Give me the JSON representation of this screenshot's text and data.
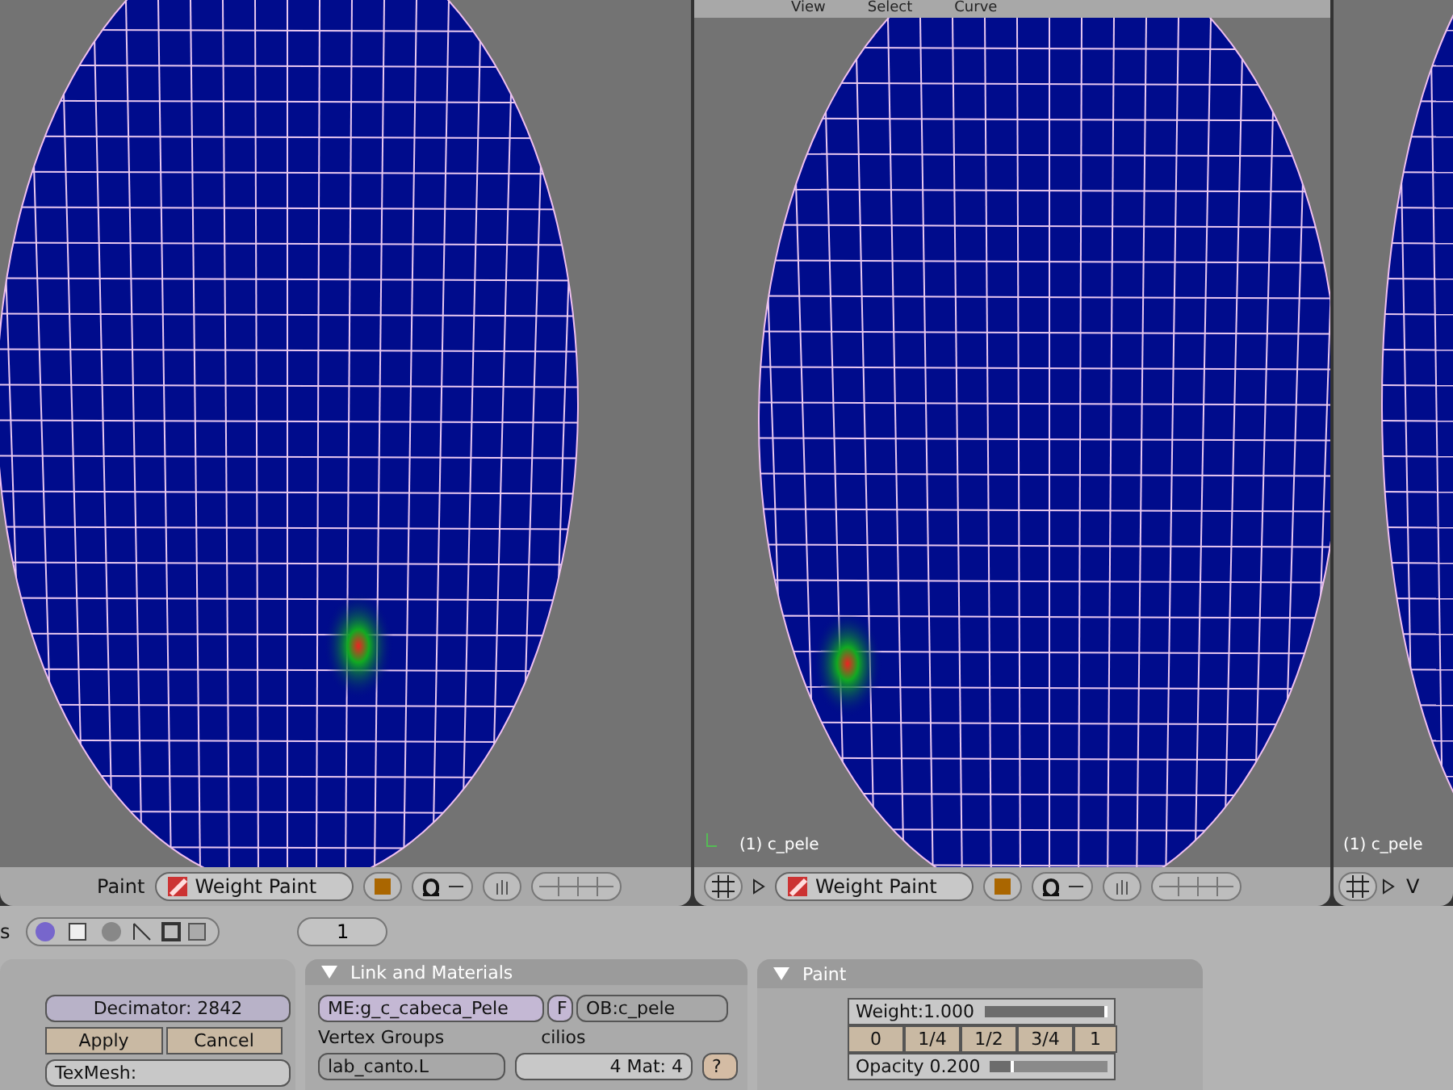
{
  "viewports": [
    {
      "header": {
        "label": "Paint",
        "mode": "Weight Paint"
      }
    },
    {
      "menu": [
        "View",
        "Select",
        "Curve"
      ],
      "object_label": "(1) c_pele",
      "header": {
        "mode": "Weight Paint",
        "expander": true
      }
    },
    {
      "object_label": "(1) c_pele",
      "header": {
        "mode": "V",
        "expander": true
      }
    }
  ],
  "buttons_header": {
    "cut_label": "s",
    "frame": "1"
  },
  "modifier_panel": {
    "decimator": "Decimator: 2842",
    "apply": "Apply",
    "cancel": "Cancel",
    "texmesh": "TexMesh:"
  },
  "link_panel": {
    "title": "Link and Materials",
    "expanded": true,
    "mesh": "ME:g_c_cabeca_Pele",
    "fake": "F",
    "object": "OB:c_pele",
    "vertex_groups_label": "Vertex Groups",
    "material_label": "cilios",
    "vertex_group": "lab_canto.L",
    "material": "4 Mat: 4",
    "help": "?"
  },
  "paint_panel": {
    "title": "Paint",
    "expanded": true,
    "weight": {
      "label": "Weight:1.000",
      "level": 1.0
    },
    "presets": [
      "0",
      "1/4",
      "1/2",
      "3/4",
      "1"
    ],
    "opacity": {
      "label": "Opacity 0.200",
      "level": 0.2
    }
  }
}
